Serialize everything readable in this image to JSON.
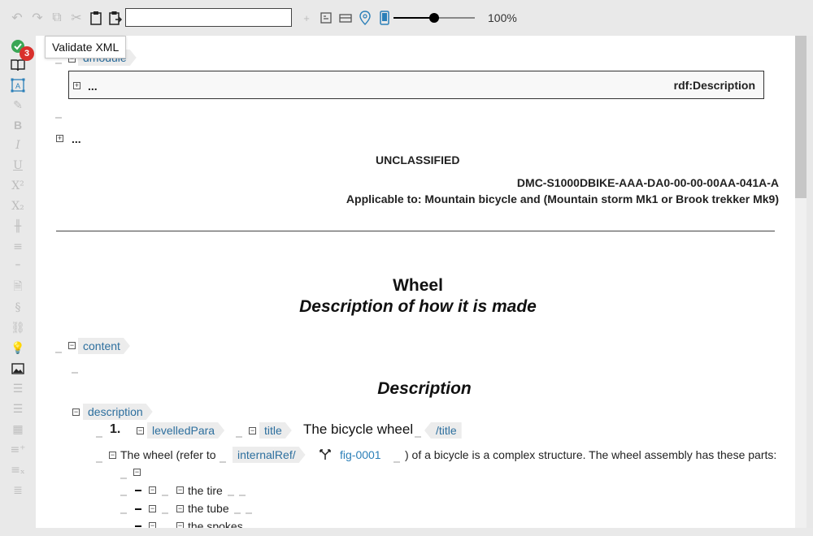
{
  "toolbar": {
    "search_value": "",
    "zoom": "100%",
    "zoom_percent": 50
  },
  "tooltip": "Validate XML",
  "badge_count": "3",
  "document": {
    "dmodule_tag": "dmodule",
    "rdf_ellipsis": "...",
    "rdf_label": "rdf:Description",
    "ellipsis2": "...",
    "classification": "UNCLASSIFIED",
    "dmc": "DMC-S1000DBIKE-AAA-DA0-00-00-00AA-041A-A",
    "applicable": "Applicable to: Mountain bicycle and (Mountain storm Mk1 or Brook trekker Mk9)",
    "title": "Wheel",
    "subtitle": "Description of how it is made",
    "content_tag": "content",
    "section_heading": "Description",
    "description_tag": "description",
    "para_number": "1.",
    "levelledpara_tag": "levelledPara",
    "title_tag": "title",
    "para_title": "The bicycle wheel",
    "title_close_tag": "/title",
    "sentence_start": "The wheel (refer to",
    "internalref_tag": "internalRef/",
    "fig_ref": "fig-0001",
    "sentence_end": ") of a bicycle is a complex structure. The wheel assembly has these parts:",
    "list_items": [
      "the tire",
      "the tube",
      "the spokes"
    ]
  }
}
